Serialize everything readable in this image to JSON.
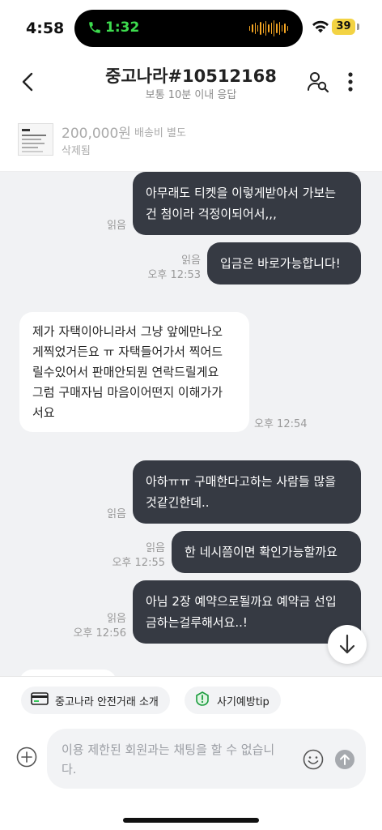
{
  "status_bar": {
    "time": "4:58",
    "call_timer": "1:32",
    "battery": "39"
  },
  "header": {
    "title": "중고나라#10512168",
    "subtitle": "보통 10분 이내 응답"
  },
  "product": {
    "price": "200,000원",
    "shipping": "배송비 별도",
    "status": "삭제됨"
  },
  "messages": [
    {
      "side": "out",
      "lines": [
        "아무래도 티켓을 이렇게받아서 가보는",
        "건 첨이라 걱정이되어서,,,"
      ],
      "read": "읽음",
      "time": ""
    },
    {
      "side": "out",
      "lines": [
        "입금은 바로가능합니다!"
      ],
      "read": "읽음",
      "time": "오후 12:53"
    },
    {
      "side": "in",
      "lines": [
        "제가 자택이아니라서 그냥 앞에만나오",
        "게찍었거든요 ㅠ 자택들어가서 찍어드",
        "릴수있어서 판매안되뭔 연락드릴게요",
        "그럼 구매자님 마음이어떤지 이해가가",
        "서요"
      ],
      "time": "오후 12:54"
    },
    {
      "side": "out",
      "lines": [
        "아하ㅠㅠ 구매한다고하는 사람들 많을",
        "것같긴한데.."
      ],
      "read": "읽음",
      "time": ""
    },
    {
      "side": "out",
      "lines": [
        "한 네시쯤이면 확인가능할까요"
      ],
      "read": "읽음",
      "time": "오후 12:55"
    },
    {
      "side": "out",
      "lines": [
        "아님 2장 예약으로될까요 예약금 선입",
        "금하는걸루해서요..!"
      ],
      "read": "읽음",
      "time": "오후 12:56"
    }
  ],
  "chips": {
    "safe_trade": "중고나라 안전거래 소개",
    "fraud_tip": "사기예방tip"
  },
  "input": {
    "placeholder": "이용 제한된 회원과는 채팅을 할 수 없습니다."
  },
  "colors": {
    "out_bubble": "#363a43",
    "in_bubble": "#ffffff",
    "chat_bg": "#f1f2f4",
    "call_green": "#3ddc4e",
    "battery": "#f3d343"
  },
  "icons": [
    "back-arrow-icon",
    "user-search-icon",
    "more-vertical-icon",
    "chevron-down-icon",
    "card-icon",
    "shield-bell-icon",
    "plus-circle-icon",
    "emoji-icon",
    "send-arrow-icon",
    "phone-icon",
    "wifi-icon"
  ]
}
